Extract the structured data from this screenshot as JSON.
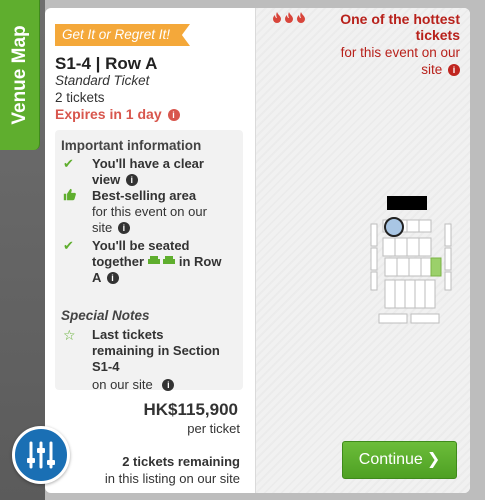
{
  "venue_tab": {
    "label": "Venue Map"
  },
  "listing": {
    "ribbon": "Get It or Regret It!",
    "title": "S1-4 | Row A",
    "ticket_class": "Standard Ticket",
    "ticket_count": "2 tickets",
    "expires": "Expires in 1 day"
  },
  "important": {
    "heading": "Important information",
    "items": [
      {
        "icon": "check-icon",
        "line1": "You'll have a clear",
        "line2": "view"
      },
      {
        "icon": "thumbs-up-icon",
        "bold": "Best-selling area",
        "line2": "for this event on our",
        "line3": "site"
      },
      {
        "icon": "check-icon",
        "line1": "You'll be seated",
        "line2a": "together",
        "line2b": "in Row",
        "line3": "A"
      }
    ]
  },
  "special": {
    "heading": "Special Notes",
    "item": {
      "icon": "star-outline-icon",
      "line1": "Last tickets",
      "line2": "remaining in Section",
      "line3": "S1-4",
      "line4": "on our site"
    }
  },
  "price": {
    "amount": "HK$115,900",
    "unit": "per ticket"
  },
  "availability": {
    "remaining": "2 tickets remaining",
    "note": "in this listing on our site"
  },
  "hot": {
    "line1": "One of the hottest",
    "line2": "tickets",
    "line3": "for this event on our",
    "line4": "site"
  },
  "buttons": {
    "continue": "Continue"
  },
  "colors": {
    "green": "#5fae2e",
    "orange": "#f4a83a",
    "red": "#d8564d",
    "dark_red": "#b8211b",
    "blue": "#1a6fb4"
  }
}
